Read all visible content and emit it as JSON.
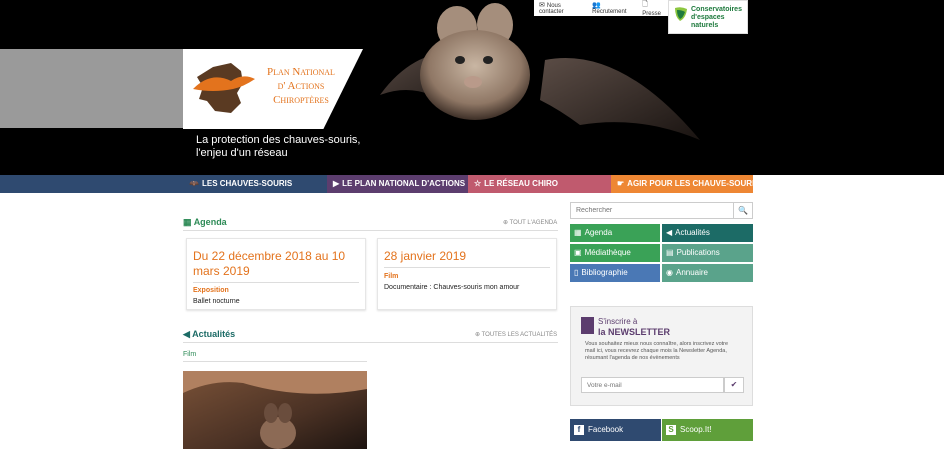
{
  "header": {
    "logo_lines": [
      "Plan National",
      "d' Actions",
      "Chiroptères"
    ],
    "tagline": [
      "La protection des chauves-souris,",
      "l'enjeu d'un réseau"
    ],
    "top_links": [
      {
        "label": "Nous contacter",
        "icon": "envelope-icon"
      },
      {
        "label": "Recrutement",
        "icon": "users-icon"
      },
      {
        "label": "Presse",
        "icon": "document-icon"
      }
    ],
    "partner_logo": [
      "Conservatoires",
      "d'espaces",
      "naturels"
    ]
  },
  "nav": [
    {
      "label": "LES CHAUVES-SOURIS",
      "icon": "bat-icon",
      "color": "#2f4a70"
    },
    {
      "label": "LE PLAN NATIONAL D'ACTIONS",
      "icon": "bookmark-icon",
      "color": "#5c3d6e"
    },
    {
      "label": "LE RÉSEAU CHIRO",
      "icon": "star-icon",
      "color": "#c05a6e"
    },
    {
      "label": "AGIR POUR LES CHAUVE-SOURIS",
      "icon": "hand-icon",
      "color": "#ee8734"
    }
  ],
  "agenda": {
    "title": "Agenda",
    "all_link": "TOUT L'AGENDA",
    "cards": [
      {
        "date": "Du 22 décembre 2018 au 10 mars 2019",
        "type": "Exposition",
        "desc": "Ballet nocturne"
      },
      {
        "date": "28 janvier 2019",
        "type": "Film",
        "desc": "Documentaire : Chauves-souris mon amour"
      }
    ]
  },
  "news": {
    "title": "Actualités",
    "all_link": "TOUTES LES ACTUALITÉS",
    "first_label": "Film"
  },
  "sidebar": {
    "search_placeholder": "Rechercher",
    "tiles": [
      {
        "label": "Agenda",
        "icon": "calendar-icon",
        "color": "#3aa257"
      },
      {
        "label": "Actualités",
        "icon": "megaphone-icon",
        "color": "#1c6b66"
      },
      {
        "label": "Médiathèque",
        "icon": "image-icon",
        "color": "#3aa257"
      },
      {
        "label": "Publications",
        "icon": "book-icon",
        "color": "#5aa38b"
      },
      {
        "label": "Bibliographie",
        "icon": "file-icon",
        "color": "#4a78b5"
      },
      {
        "label": "Annuaire",
        "icon": "user-icon",
        "color": "#5aa38b"
      }
    ],
    "newsletter": {
      "title_small": "S'inscrire à",
      "title_big": "la NEWSLETTER",
      "text": "Vous souhaitez mieux nous connaître, alors inscrivez votre mail ici, vous recevrez chaque mois la Newsletter Agenda, résumant l'agenda de nos évènements",
      "input_placeholder": "Votre e-mail"
    },
    "social": [
      {
        "label": "Facebook",
        "color": "#2f4a70"
      },
      {
        "label": "Scoop.It!",
        "color": "#5f9f3a"
      }
    ]
  }
}
